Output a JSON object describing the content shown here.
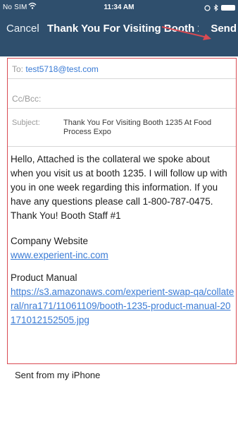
{
  "status": {
    "carrier": "No SIM",
    "time": "11:34 AM"
  },
  "nav": {
    "cancel_label": "Cancel",
    "title": "Thank You For Visiting Booth 12...",
    "send_label": "Send"
  },
  "fields": {
    "to_label": "To:",
    "to_value": "test5718@test.com",
    "ccbcc_label": "Cc/Bcc:",
    "subject_label": "Subject:",
    "subject_value": "Thank You For Visiting Booth 1235 At Food Process Expo"
  },
  "body": {
    "message": "Hello, Attached is the collateral we spoke about when you visit us at booth 1235. I will follow up with you in one week regarding this information. If you have any questions please call 1-800-787-0475. Thank You! Booth Staff #1",
    "website_label": "Company Website",
    "website_link": "www.experient-inc.com",
    "manual_label": "Product Manual",
    "manual_link": "https://s3.amazonaws.com/experient-swap-qa/collateral/nra171/11061109/booth-1235-product-manual-20171012152505.jpg",
    "signature": "Sent from my iPhone"
  },
  "colors": {
    "nav_background": "#2f4f6d",
    "link": "#3a7bd5",
    "annotation_red": "#d94a52"
  }
}
